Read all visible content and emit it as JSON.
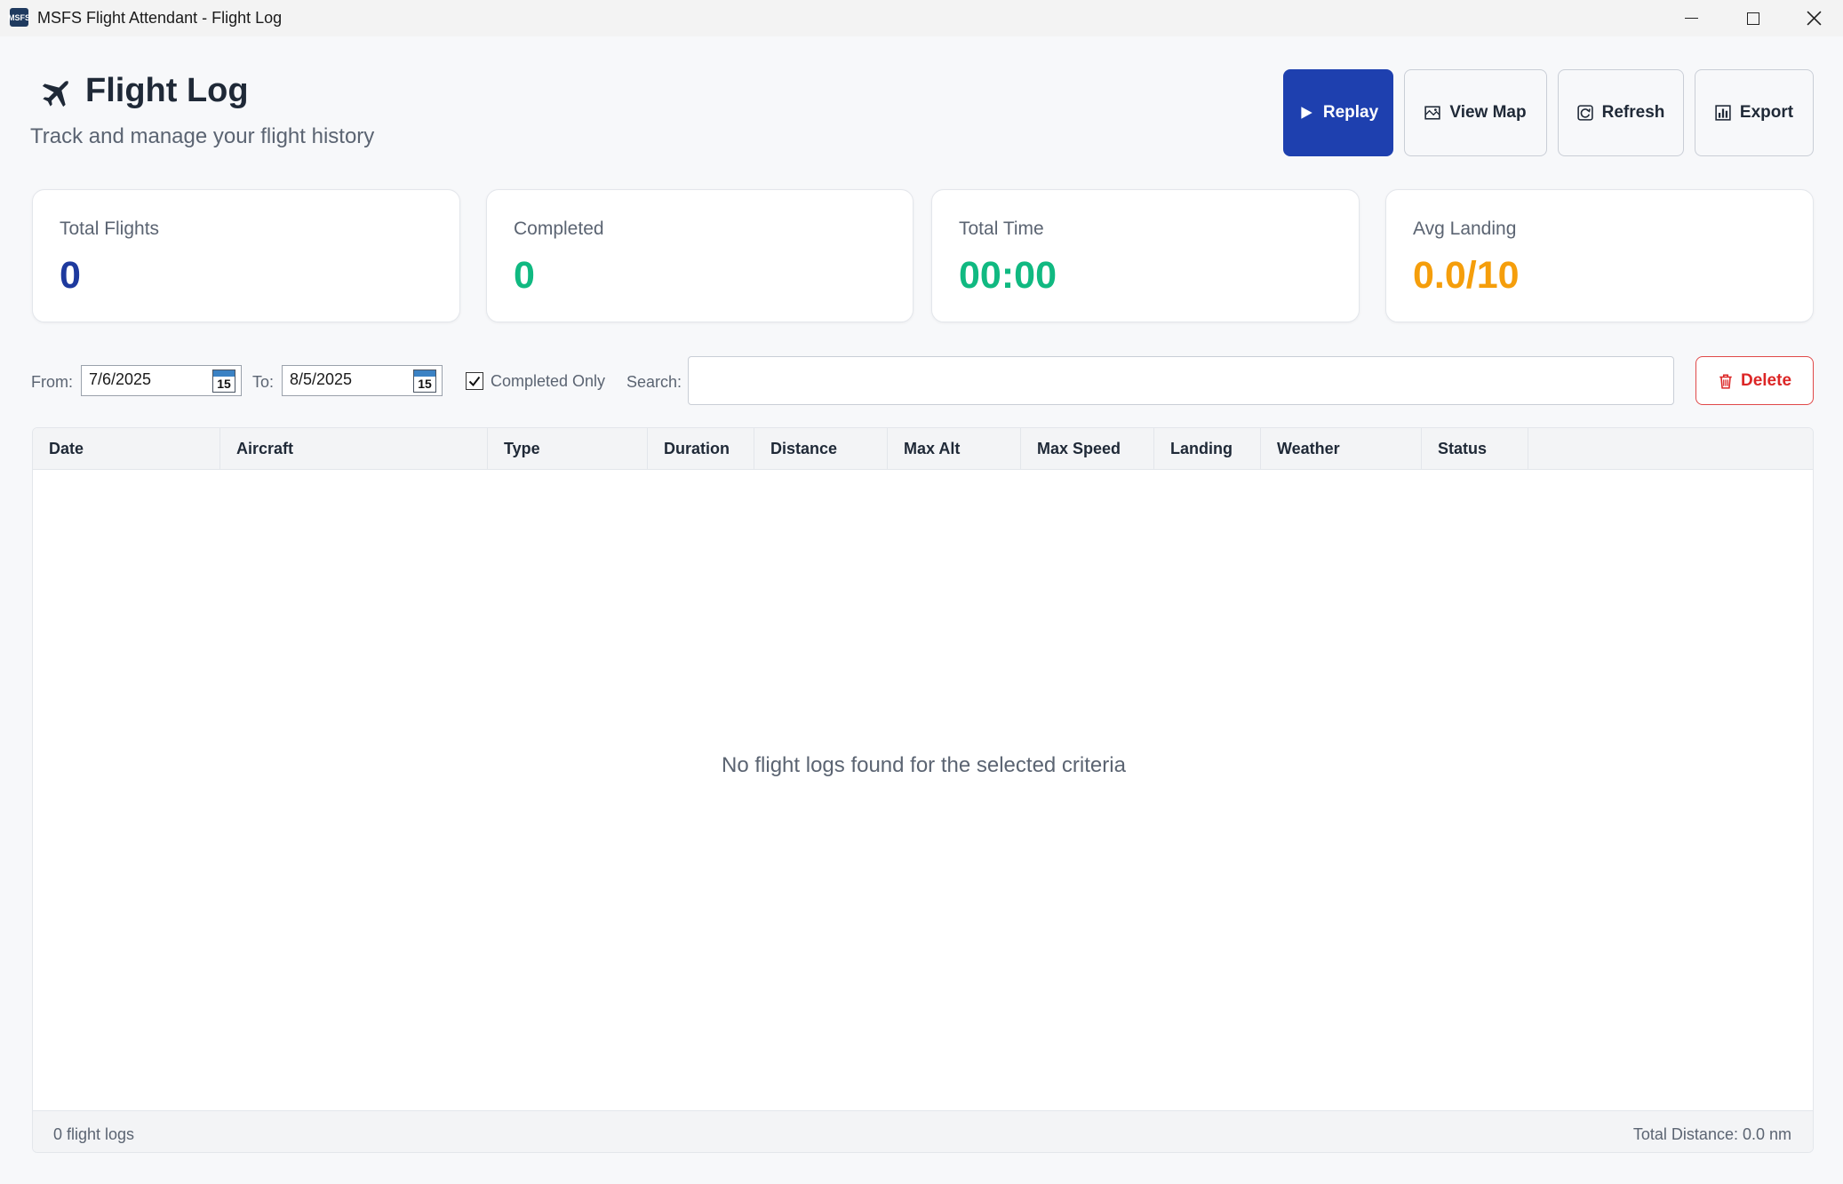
{
  "window": {
    "title": "MSFS Flight Attendant - Flight Log",
    "app_icon_text": "MSFS"
  },
  "header": {
    "title": "Flight Log",
    "subtitle": "Track and manage your flight history"
  },
  "toolbar": {
    "replay_label": "Replay",
    "view_map_label": "View Map",
    "refresh_label": "Refresh",
    "export_label": "Export"
  },
  "stats": [
    {
      "label": "Total Flights",
      "value": "0",
      "color": "#1e3a9e"
    },
    {
      "label": "Completed",
      "value": "0",
      "color": "#10b981"
    },
    {
      "label": "Total Time",
      "value": "00:00",
      "color": "#10b981"
    },
    {
      "label": "Avg Landing",
      "value": "0.0/10",
      "color": "#f59e0b"
    }
  ],
  "filters": {
    "from_label": "From:",
    "from_value": "7/6/2025",
    "to_label": "To:",
    "to_value": "8/5/2025",
    "calendar_day": "15",
    "completed_only_label": "Completed Only",
    "completed_only_checked": true,
    "search_label": "Search:",
    "search_value": "",
    "delete_label": "Delete"
  },
  "table": {
    "columns": [
      "Date",
      "Aircraft",
      "Type",
      "Duration",
      "Distance",
      "Max Alt",
      "Max Speed",
      "Landing",
      "Weather",
      "Status"
    ],
    "rows": [],
    "empty_message": "No flight logs found for the selected criteria"
  },
  "footer": {
    "count_text": "0 flight logs",
    "total_distance_text": "Total Distance: 0.0 nm"
  }
}
